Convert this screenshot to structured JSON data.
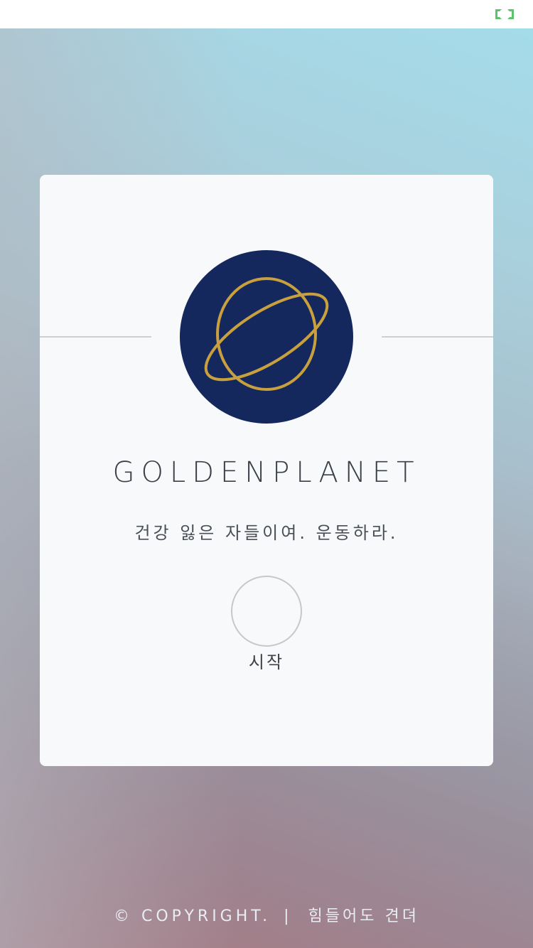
{
  "status_bar": {
    "indicator_icon": "bracket-pill-icon",
    "indicator_color": "#5cc36a"
  },
  "colors": {
    "card_bg": "#f8f9fa",
    "logo_circle": "#15285e",
    "logo_ring": "#c9a03e",
    "brand_text": "#3b4048"
  },
  "card": {
    "logo_icon": "golden-planet-icon",
    "brand_name": "GOLDENPLANET",
    "slogan": "건강 잃은 자들이여. 운동하라.",
    "start_label": "시작"
  },
  "footer": {
    "copyright": "© COPYRIGHT.",
    "separator": "|",
    "motto": "힘들어도 견뎌"
  }
}
